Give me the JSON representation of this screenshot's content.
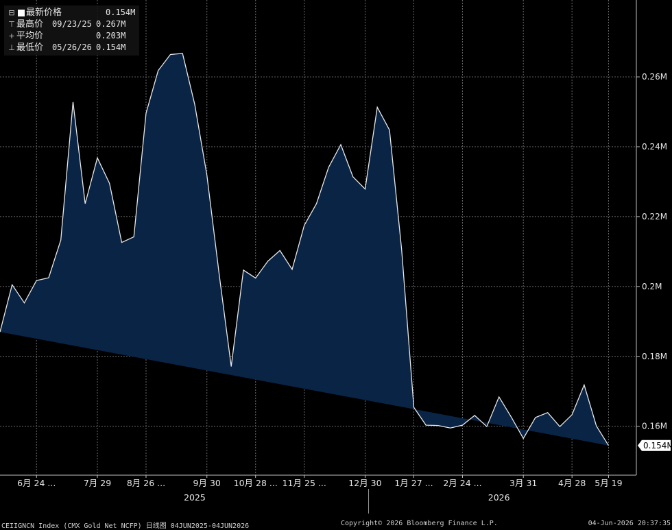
{
  "legend": {
    "last": {
      "label": "最新价格",
      "value": "0.154M"
    },
    "high": {
      "label": "最高价",
      "date": "09/23/25",
      "value": "0.267M"
    },
    "avg": {
      "label": "平均价",
      "value": "0.203M"
    },
    "low": {
      "label": "最低价",
      "date": "05/26/26",
      "value": "0.154M"
    }
  },
  "footer": {
    "left": "CEIIGNCN Index (CMX Gold Net NCFP) 日线图 04JUN2025-04JUN2026",
    "center": "Copyright© 2026 Bloomberg Finance L.P.",
    "right": "04-Jun-2026 20:37:35"
  },
  "chart_data": {
    "type": "area",
    "title": "CEIIGNCN Index (CMX Gold Net NCFP)",
    "colors": {
      "fill": "#0a2445",
      "line": "#e8e8e8",
      "grid": "#6a6a6a",
      "background": "#000000",
      "last_label_bg": "#ffffff"
    },
    "grid": true,
    "ylim": [
      0.146,
      0.282
    ],
    "yticks": [
      0.16,
      0.18,
      0.2,
      0.22,
      0.24,
      0.26
    ],
    "ytick_labels": [
      "0.16M",
      "0.18M",
      "0.2M",
      "0.22M",
      "0.24M",
      "0.26M"
    ],
    "last_value_label": "0.154M",
    "xlim": [
      "2025-06-03",
      "2026-06-04"
    ],
    "xticks": [
      {
        "date": "2025-06-24",
        "label": "6月 24 ..."
      },
      {
        "date": "2025-07-29",
        "label": "7月 29"
      },
      {
        "date": "2025-08-26",
        "label": "8月 26 ..."
      },
      {
        "date": "2025-09-30",
        "label": "9月 30"
      },
      {
        "date": "2025-10-28",
        "label": "10月 28 ..."
      },
      {
        "date": "2025-11-25",
        "label": "11月 25 ..."
      },
      {
        "date": "2025-12-30",
        "label": "12月 30"
      },
      {
        "date": "2026-01-27",
        "label": "1月 27 ..."
      },
      {
        "date": "2026-02-24",
        "label": "2月 24 ..."
      },
      {
        "date": "2026-03-31",
        "label": "3月 31"
      },
      {
        "date": "2026-04-28",
        "label": "4月 28"
      },
      {
        "date": "2026-05-19",
        "label": "5月 19"
      }
    ],
    "year_labels": [
      {
        "date": "2025-09-23",
        "label": "2025"
      },
      {
        "date": "2026-03-17",
        "label": "2026"
      }
    ],
    "year_boundary": "2026-01-01",
    "x": [
      "2025-06-03",
      "2025-06-10",
      "2025-06-17",
      "2025-06-24",
      "2025-07-01",
      "2025-07-08",
      "2025-07-15",
      "2025-07-22",
      "2025-07-29",
      "2025-08-05",
      "2025-08-12",
      "2025-08-19",
      "2025-08-26",
      "2025-09-02",
      "2025-09-09",
      "2025-09-16",
      "2025-09-23",
      "2025-09-30",
      "2025-10-07",
      "2025-10-14",
      "2025-10-21",
      "2025-10-28",
      "2025-11-04",
      "2025-11-11",
      "2025-11-18",
      "2025-11-25",
      "2025-12-02",
      "2025-12-09",
      "2025-12-16",
      "2025-12-23",
      "2025-12-30",
      "2026-01-06",
      "2026-01-13",
      "2026-01-20",
      "2026-01-27",
      "2026-02-03",
      "2026-02-10",
      "2026-02-17",
      "2026-02-24",
      "2026-03-03",
      "2026-03-10",
      "2026-03-17",
      "2026-03-24",
      "2026-03-31",
      "2026-04-07",
      "2026-04-14",
      "2026-04-21",
      "2026-04-28",
      "2026-05-05",
      "2026-05-12",
      "2026-05-19",
      "2026-05-26"
    ],
    "y": [
      0.187,
      0.2005,
      0.1953,
      0.2017,
      0.2025,
      0.2133,
      0.2528,
      0.2237,
      0.2368,
      0.2295,
      0.2126,
      0.2142,
      0.2496,
      0.2618,
      0.2664,
      0.2667,
      0.2521,
      0.2319,
      0.2037,
      0.1771,
      0.2047,
      0.2024,
      0.2072,
      0.2103,
      0.2049,
      0.2175,
      0.2237,
      0.2341,
      0.2406,
      0.2314,
      0.2279,
      0.2513,
      0.2448,
      0.2106,
      0.1654,
      0.1603,
      0.1602,
      0.1595,
      0.1603,
      0.1631,
      0.1599,
      0.1684,
      0.1627,
      0.1565,
      0.1625,
      0.1639,
      0.1599,
      0.1633,
      0.1718,
      0.1601,
      0.1545
    ]
  }
}
